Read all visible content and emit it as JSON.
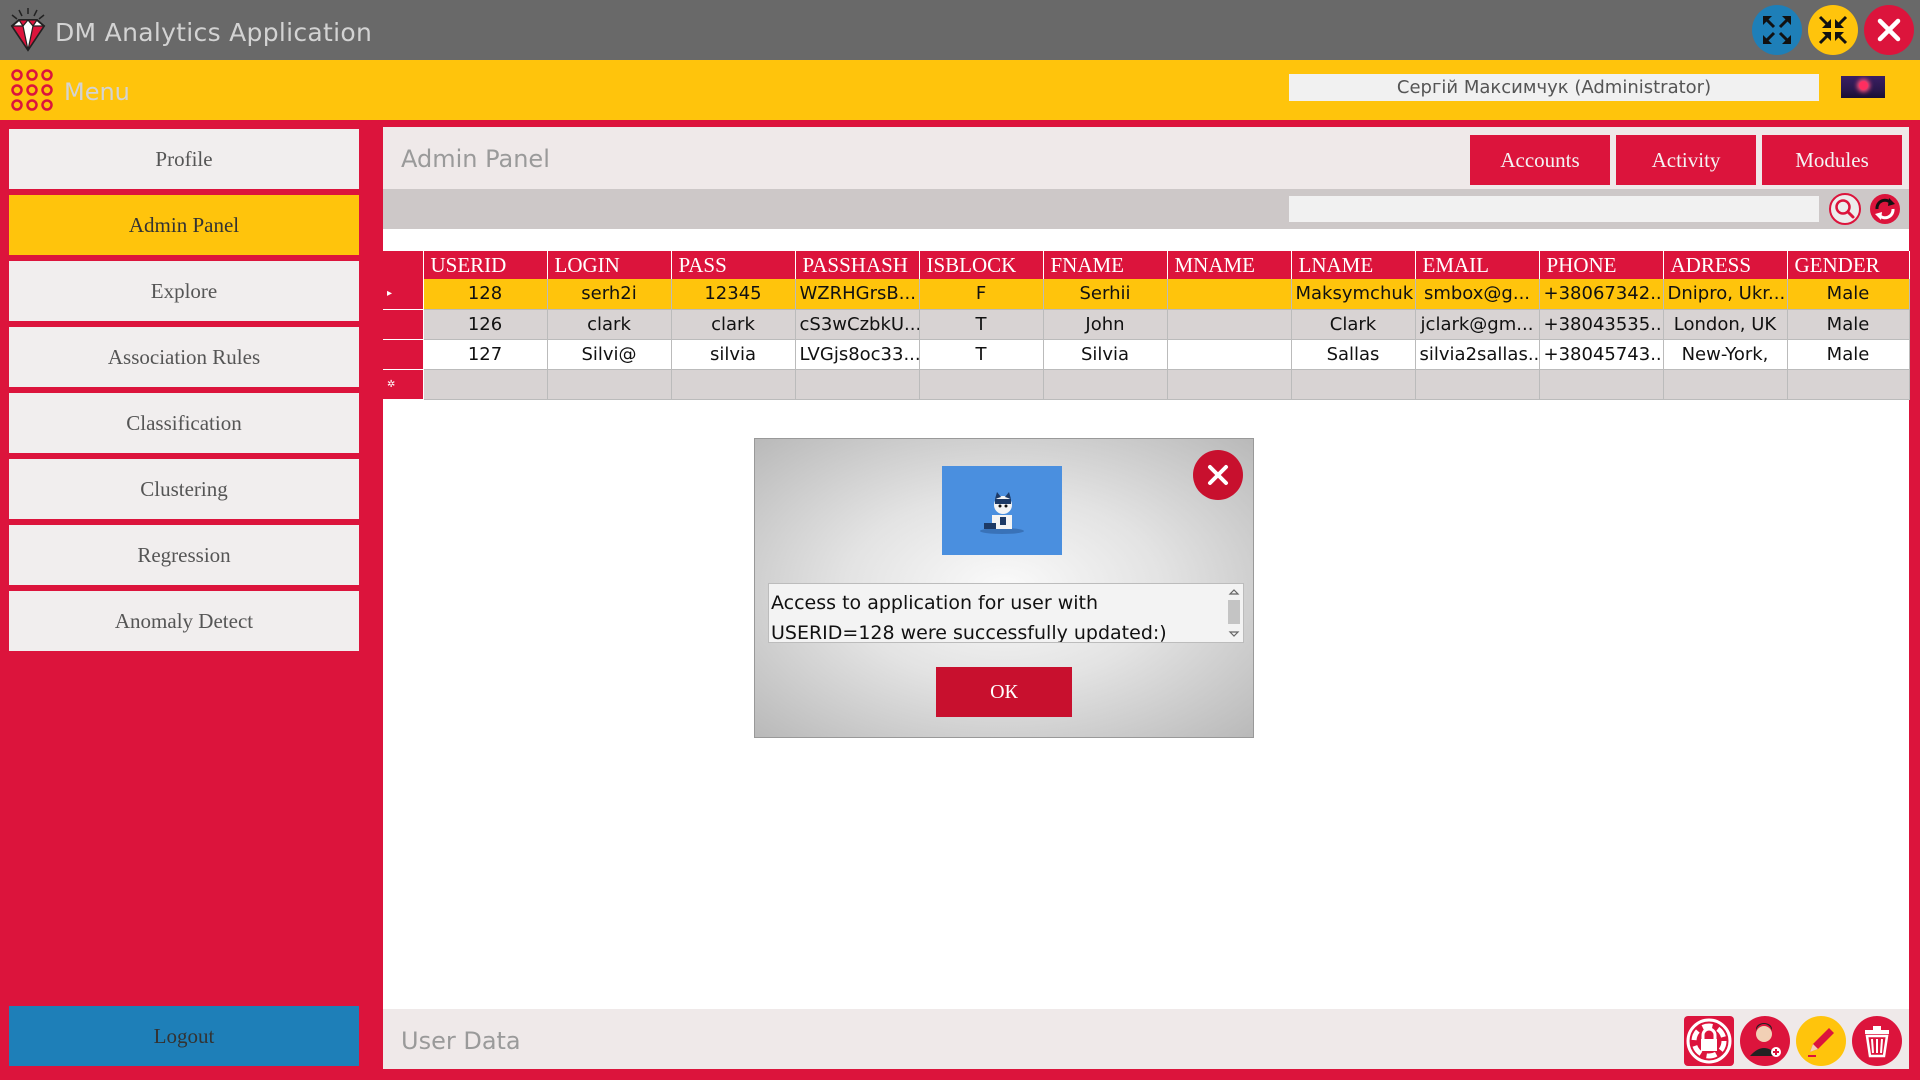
{
  "app": {
    "title": "DM Analytics Application",
    "logo_icon": "diamond-logo-icon"
  },
  "window_controls": {
    "maximize_icon": "expand-icon",
    "minimize_icon": "shrink-icon",
    "close_icon": "close-icon",
    "colors": {
      "maximize": "#1e7fb8",
      "minimize": "#ffc40c",
      "close": "#dc143c"
    }
  },
  "menubar": {
    "menu_label": "Menu",
    "menu_icon": "dots-grid-icon",
    "user": "Сергій Максимчук (Administrator)",
    "flag_icon": "language-flag-icon"
  },
  "sidebar": {
    "items": [
      {
        "label": "Profile",
        "active": false
      },
      {
        "label": "Admin Panel",
        "active": true
      },
      {
        "label": "Explore",
        "active": false
      },
      {
        "label": "Association Rules",
        "active": false
      },
      {
        "label": "Classification",
        "active": false
      },
      {
        "label": "Clustering",
        "active": false
      },
      {
        "label": "Regression",
        "active": false
      },
      {
        "label": "Anomaly Detect",
        "active": false
      }
    ],
    "logout_label": "Logout"
  },
  "panel": {
    "title": "Admin Panel",
    "tabs": [
      "Accounts",
      "Activity",
      "Modules"
    ],
    "search_value": "",
    "search_icon": "search-icon",
    "refresh_icon": "refresh-icon"
  },
  "table": {
    "columns": [
      "USERID",
      "LOGIN",
      "PASS",
      "PASSHASH",
      "ISBLOCK",
      "FNAME",
      "MNAME",
      "LNAME",
      "EMAIL",
      "PHONE",
      "ADRESS",
      "GENDER"
    ],
    "rows": [
      [
        "128",
        "serh2i",
        "12345",
        "WZRHGrsB...",
        "F",
        "Serhii",
        "",
        "Maksymchuk",
        "smbox@g...",
        "+38067342...",
        "Dnipro, Ukr...",
        "Male"
      ],
      [
        "126",
        "clark",
        "clark",
        "cS3wCzbkU...",
        "T",
        "John",
        "",
        "Clark",
        "jclark@gm...",
        "+38043535...",
        "London, UK",
        "Male"
      ],
      [
        "127",
        "Silvi@",
        "silvia",
        "LVGjs8oc33...",
        "T",
        "Silvia",
        "",
        "Sallas",
        "silvia2sallas...",
        "+38045743...",
        "New-York,",
        "Male"
      ]
    ],
    "selected_row": 0,
    "current_row_marker": "▸",
    "new_row_marker": "✲"
  },
  "footer": {
    "title": "User Data",
    "buttons": [
      "lock-icon",
      "add-user-icon",
      "edit-pencil-icon",
      "delete-trash-icon"
    ]
  },
  "dialog": {
    "image_icon": "cat-figure-icon",
    "message": "Access to application for user with USERID=128 were successfully updated:)",
    "ok_label": "ОК",
    "close_icon": "close-icon"
  }
}
